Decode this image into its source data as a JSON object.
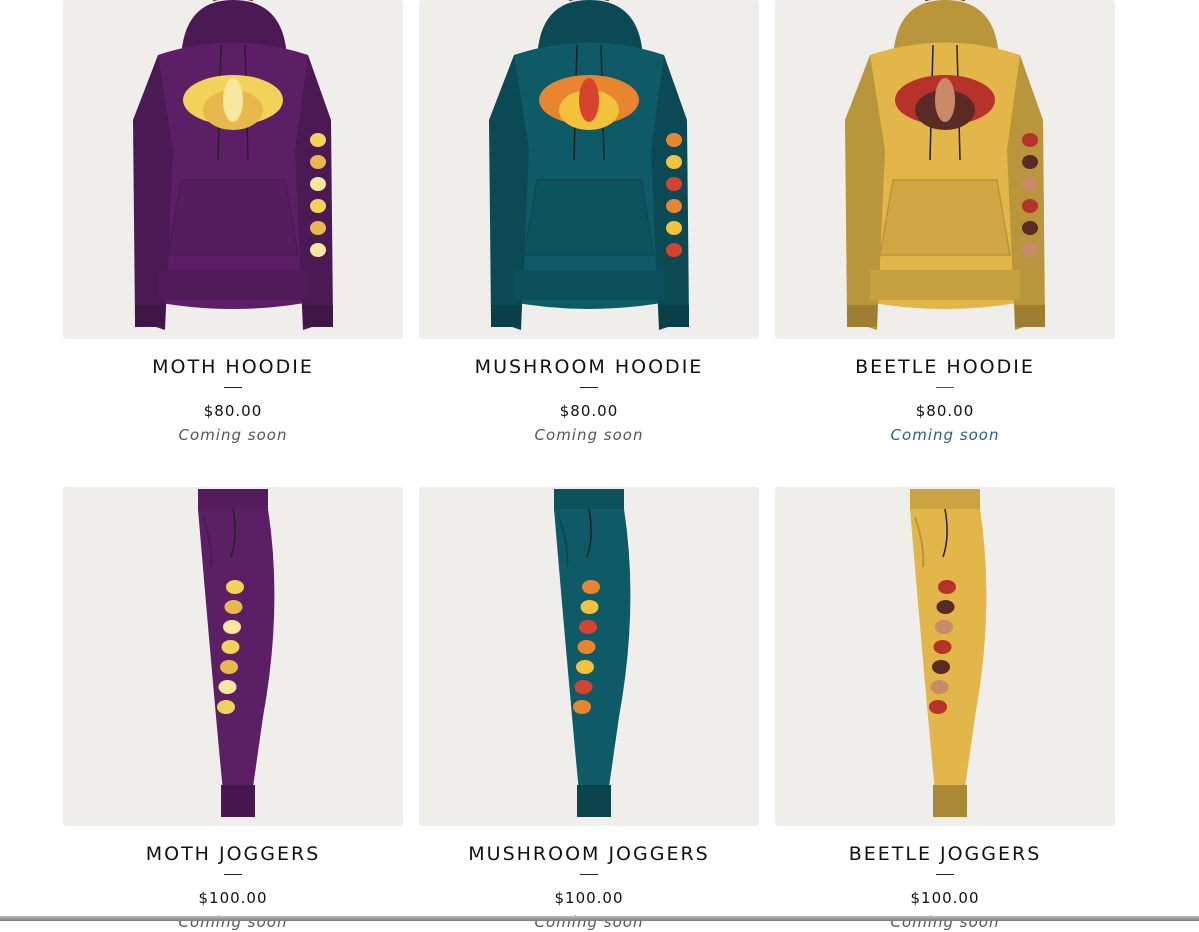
{
  "products": [
    {
      "title": "MOTH HOODIE",
      "price": "$80.00",
      "status": "Coming soon",
      "garment": "hoodie",
      "color": "#5c1f66",
      "art": "moth",
      "icon": "moth-hoodie-image"
    },
    {
      "title": "MUSHROOM HOODIE",
      "price": "$80.00",
      "status": "Coming soon",
      "garment": "hoodie",
      "color": "#0e5a66",
      "art": "mushroom",
      "icon": "mushroom-hoodie-image"
    },
    {
      "title": "BEETLE HOODIE",
      "price": "$80.00",
      "status": "Coming soon",
      "garment": "hoodie",
      "color": "#e2b648",
      "art": "beetle",
      "icon": "beetle-hoodie-image"
    },
    {
      "title": "MOTH JOGGERS",
      "price": "$100.00",
      "status": "Coming soon",
      "garment": "joggers",
      "color": "#5c1f66",
      "art": "moth",
      "icon": "moth-joggers-image"
    },
    {
      "title": "MUSHROOM JOGGERS",
      "price": "$100.00",
      "status": "Coming soon",
      "garment": "joggers",
      "color": "#0e5a66",
      "art": "mushroom",
      "icon": "mushroom-joggers-image"
    },
    {
      "title": "BEETLE JOGGERS",
      "price": "$100.00",
      "status": "Coming soon",
      "garment": "joggers",
      "color": "#e2b648",
      "art": "beetle",
      "icon": "beetle-joggers-image"
    }
  ],
  "colors": {
    "card_bg": "#efeeeb",
    "link": "#2a5d8a",
    "text": "#111111",
    "muted": "#555555"
  }
}
